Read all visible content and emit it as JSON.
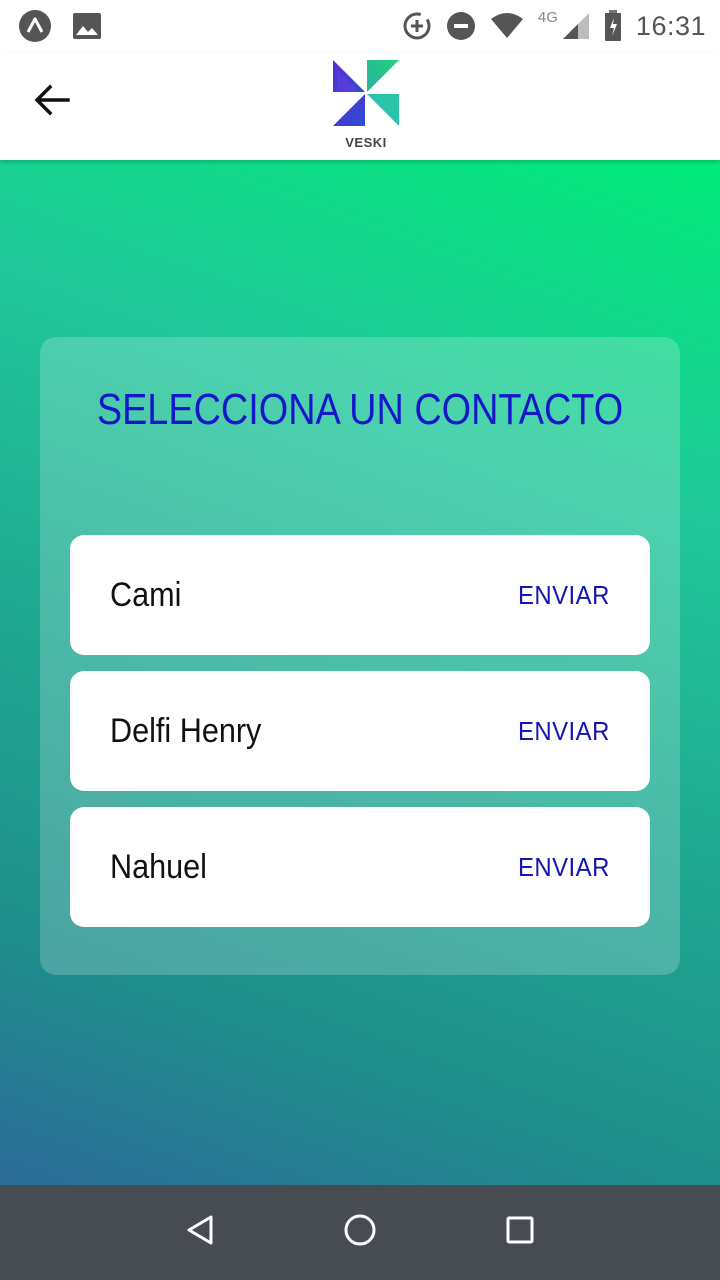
{
  "status_bar": {
    "time": "16:31",
    "network": "4G",
    "left_icons": [
      "app-notification-icon",
      "image-notification-icon"
    ],
    "right_icons": [
      "data-saver-icon",
      "do-not-disturb-icon",
      "wifi-icon",
      "cell-signal-icon",
      "battery-icon"
    ]
  },
  "app_bar": {
    "back_icon": "arrow-left-icon",
    "logo_text": "VESKI"
  },
  "main": {
    "title": "SELECCIONA UN CONTACTO",
    "contacts": [
      {
        "name": "Cami",
        "action": "ENVIAR"
      },
      {
        "name": "Delfi Henry",
        "action": "ENVIAR"
      },
      {
        "name": "Nahuel",
        "action": "ENVIAR"
      }
    ]
  },
  "nav_bar": {
    "buttons": [
      "back-triangle-icon",
      "home-circle-icon",
      "recents-square-icon"
    ]
  },
  "colors": {
    "title": "#1518c8",
    "action": "#1414b0",
    "gradient_top": "#00ea78",
    "gradient_bottom": "#2b6b99",
    "nav_bar": "#464c52"
  }
}
